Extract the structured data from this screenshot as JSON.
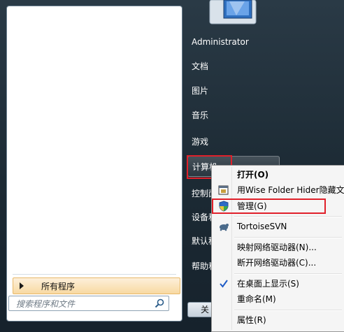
{
  "user": {
    "name": "Administrator"
  },
  "right_pane": {
    "items": [
      {
        "label": "文档"
      },
      {
        "label": "图片"
      },
      {
        "label": "音乐"
      },
      {
        "label": "游戏"
      },
      {
        "label": "计算机"
      },
      {
        "label": "控制面"
      },
      {
        "label": "设备和"
      },
      {
        "label": "默认程"
      },
      {
        "label": "帮助和"
      }
    ],
    "shutdown_label": "关"
  },
  "left_pane": {
    "all_programs_label": "所有程序",
    "search_placeholder": "搜索程序和文件"
  },
  "context_menu": {
    "items": [
      {
        "label": "打开(O)",
        "bold": true
      },
      {
        "label": "用Wise Folder Hider隐藏文"
      },
      {
        "label": "管理(G)"
      },
      {
        "label": "TortoiseSVN"
      },
      {
        "label": "映射网络驱动器(N)..."
      },
      {
        "label": "断开网络驱动器(C)..."
      },
      {
        "label": "在桌面上显示(S)",
        "checked": true
      },
      {
        "label": "重命名(M)"
      },
      {
        "label": "属性(R)"
      }
    ]
  },
  "colors": {
    "highlight_red": "#e0202a",
    "menu_bg": "#f5f5f5",
    "check_blue": "#1e5bc6"
  }
}
